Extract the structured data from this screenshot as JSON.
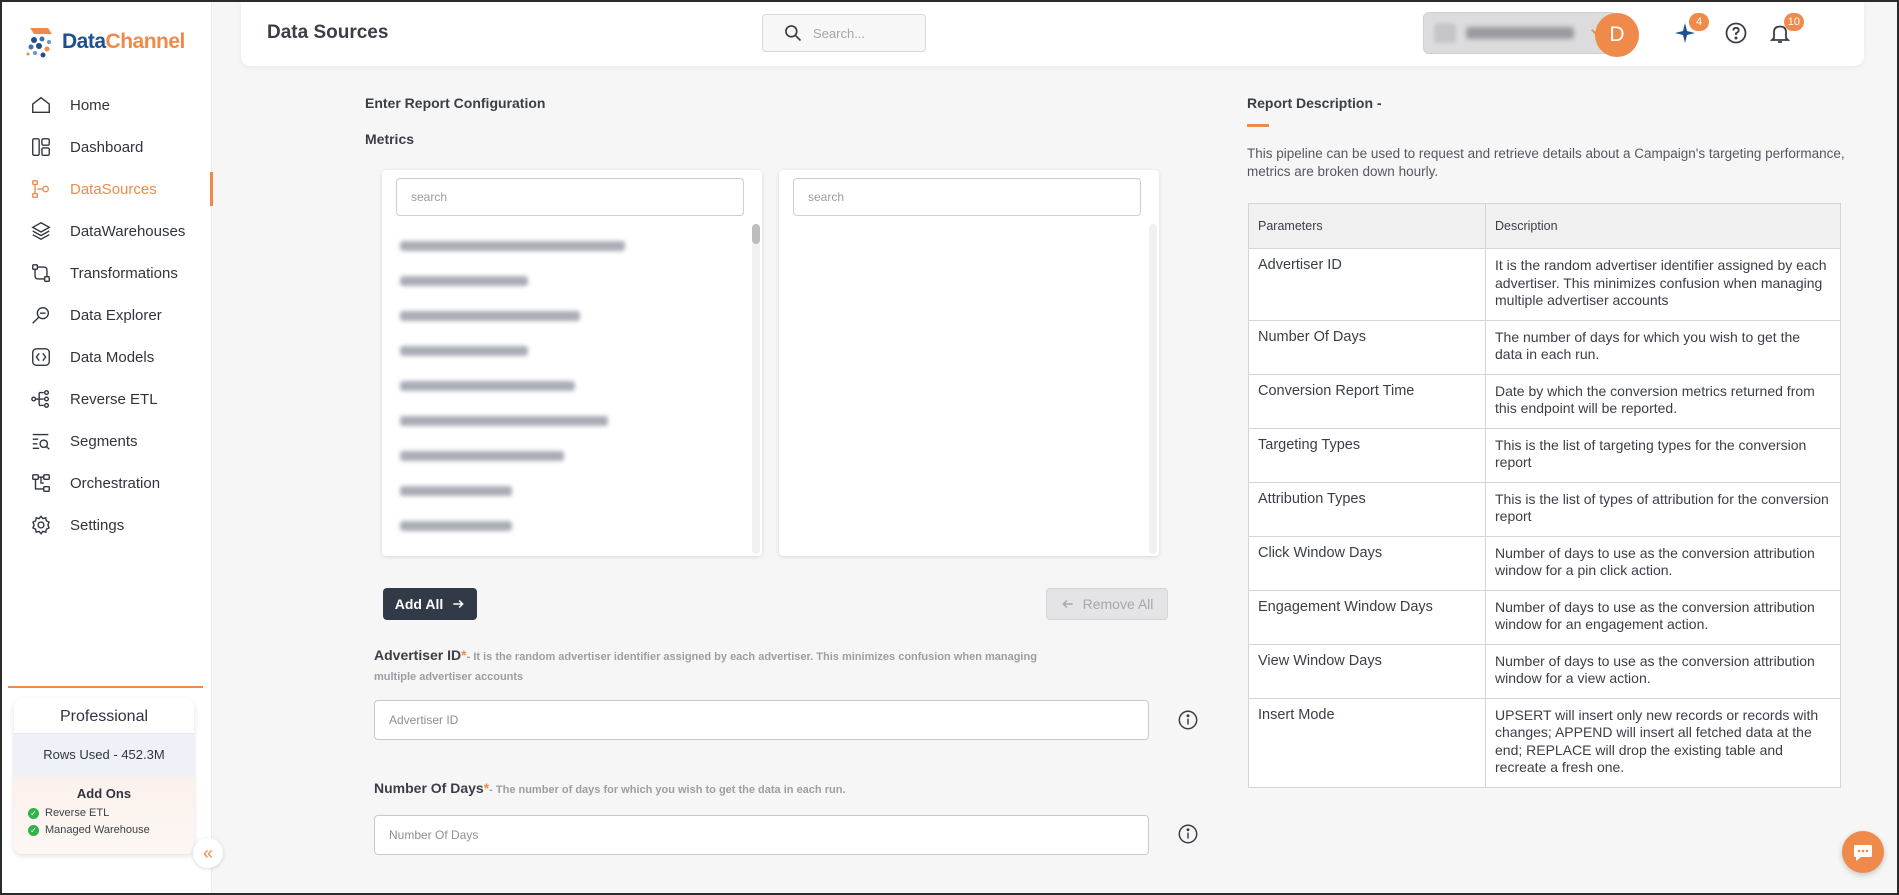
{
  "brand": {
    "name_part1": "Data",
    "name_part2": "Channel",
    "accent": "#f08a4b",
    "navy": "#1f4f8f"
  },
  "sidebar": {
    "items": [
      {
        "label": "Home",
        "icon": "home-icon"
      },
      {
        "label": "Dashboard",
        "icon": "dashboard-icon"
      },
      {
        "label": "DataSources",
        "icon": "datasources-icon",
        "active": true
      },
      {
        "label": "DataWarehouses",
        "icon": "layers-icon"
      },
      {
        "label": "Transformations",
        "icon": "transform-icon"
      },
      {
        "label": "Data Explorer",
        "icon": "explorer-icon"
      },
      {
        "label": "Data Models",
        "icon": "models-icon"
      },
      {
        "label": "Reverse ETL",
        "icon": "reverse-etl-icon"
      },
      {
        "label": "Segments",
        "icon": "segments-icon"
      },
      {
        "label": "Orchestration",
        "icon": "orchestration-icon"
      },
      {
        "label": "Settings",
        "icon": "gear-icon"
      }
    ],
    "plan": {
      "title": "Professional",
      "rows_used": "Rows Used - 452.3M",
      "addons_title": "Add Ons",
      "addons": [
        "Reverse ETL",
        "Managed Warehouse"
      ]
    },
    "collapse_glyph": "«"
  },
  "header": {
    "title": "Data Sources",
    "search_placeholder": "Search...",
    "sparkle_badge": "4",
    "notification_badge": "10",
    "avatar_initial": "D"
  },
  "form": {
    "section_title": "Enter Report Configuration",
    "metrics_label": "Metrics",
    "available_search_placeholder": "search",
    "selected_search_placeholder": "search",
    "add_all_label": "Add All",
    "remove_all_label": "Remove All",
    "fields": [
      {
        "label": "Advertiser ID",
        "required_mark": "*",
        "hint": "- It is the random advertiser identifier assigned by each advertiser. This minimizes confusion when managing multiple advertiser accounts",
        "placeholder": "Advertiser ID"
      },
      {
        "label": "Number Of Days",
        "required_mark": "*",
        "hint": "- The number of days for which you wish to get the data in each run.",
        "placeholder": "Number Of Days"
      }
    ]
  },
  "description": {
    "title": "Report Description -",
    "text": "This pipeline can be used to request and retrieve details about a Campaign's targeting performance, metrics are broken down hourly.",
    "table": {
      "headers": [
        "Parameters",
        "Description"
      ],
      "rows": [
        [
          "Advertiser ID",
          "It is the random advertiser identifier assigned by each advertiser. This minimizes confusion when managing multiple advertiser accounts"
        ],
        [
          "Number Of Days",
          "The number of days for which you wish to get the data in each run."
        ],
        [
          "Conversion Report Time",
          "Date by which the conversion metrics returned from this endpoint will be reported."
        ],
        [
          "Targeting Types",
          "This is the list of targeting types for the conversion report"
        ],
        [
          "Attribution Types",
          "This is the list of types of attribution for the conversion report"
        ],
        [
          "Click Window Days",
          "Number of days to use as the conversion attribution window for a pin click action."
        ],
        [
          "Engagement Window Days",
          "Number of days to use as the conversion attribution window for an engagement action."
        ],
        [
          "View Window Days",
          "Number of days to use as the conversion attribution window for a view action."
        ],
        [
          "Insert Mode",
          "UPSERT will insert only new records or records with changes; APPEND will insert all fetched data at the end; REPLACE will drop the existing table and recreate a fresh one."
        ]
      ]
    }
  }
}
